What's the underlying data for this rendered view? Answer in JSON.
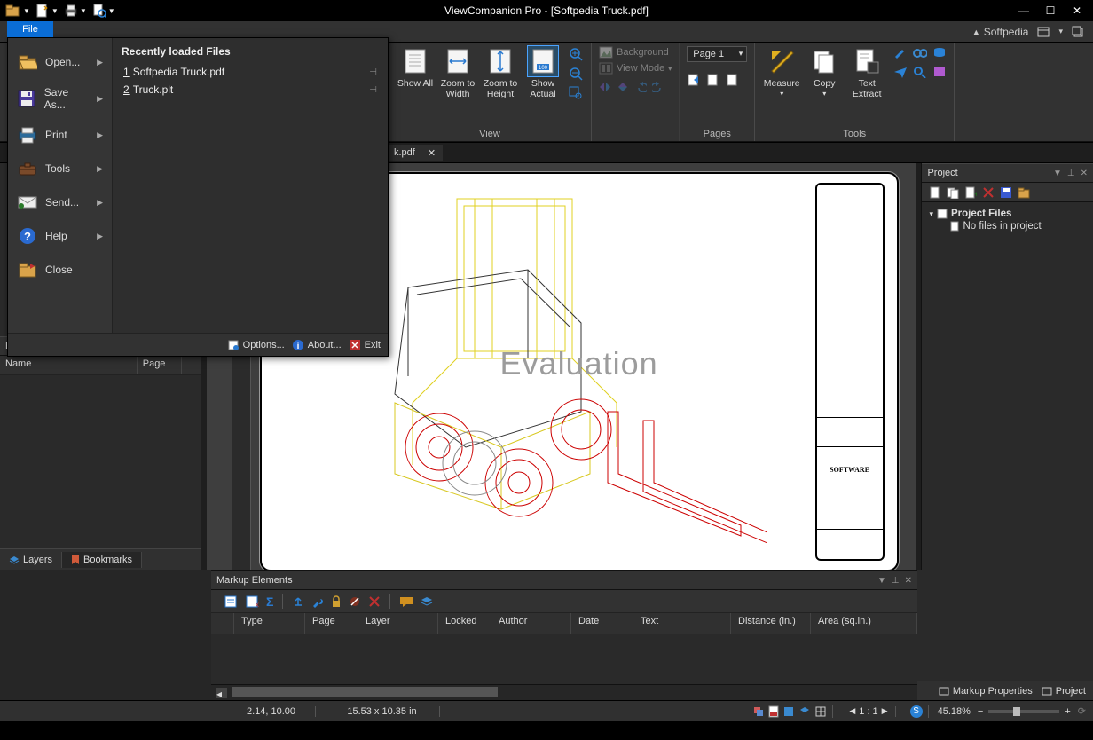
{
  "app_title": "ViewCompanion Pro - [Softpedia Truck.pdf]",
  "brand": "Softpedia",
  "file_tab_label": "File",
  "file_menu": {
    "items": [
      {
        "label": "Open...",
        "arrow": true
      },
      {
        "label": "Save As...",
        "arrow": true
      },
      {
        "label": "Print",
        "arrow": true
      },
      {
        "label": "Tools",
        "arrow": true
      },
      {
        "label": "Send...",
        "arrow": true
      },
      {
        "label": "Help",
        "arrow": true
      },
      {
        "label": "Close",
        "arrow": false
      }
    ],
    "recent_header": "Recently loaded Files",
    "recent": [
      {
        "idx": "1",
        "name": "Softpedia Truck.pdf"
      },
      {
        "idx": "2",
        "name": "Truck.plt"
      }
    ],
    "footer": {
      "options": "Options...",
      "about": "About...",
      "exit": "Exit"
    }
  },
  "ribbon": {
    "view": {
      "show_all": "Show All",
      "zoom_width": "Zoom to Width",
      "zoom_height": "Zoom to Height",
      "show_actual": "Show Actual",
      "group": "View"
    },
    "bg": {
      "background": "Background",
      "viewmode": "View Mode"
    },
    "pages": {
      "page": "Page 1",
      "group": "Pages"
    },
    "measure": "Measure",
    "copy": "Copy",
    "text_extract1": "Text",
    "text_extract2": "Extract",
    "tools_group": "Tools"
  },
  "doc_tab": {
    "name": "k.pdf"
  },
  "bookmarks": {
    "title": "Bookmarks",
    "col_name": "Name",
    "col_page": "Page"
  },
  "left_tabs": {
    "layers": "Layers",
    "bookmarks": "Bookmarks"
  },
  "watermark": "Evaluation",
  "title_block_brand": "SOFTWARE",
  "markup": {
    "title": "Markup Elements",
    "cols": {
      "type": "Type",
      "page": "Page",
      "layer": "Layer",
      "locked": "Locked",
      "author": "Author",
      "date": "Date",
      "text": "Text",
      "distance": "Distance (in.)",
      "area": "Area (sq.in.)"
    }
  },
  "project": {
    "title": "Project",
    "root": "Project Files",
    "empty": "No files in project"
  },
  "right_bottom": {
    "markup_props": "Markup Properties",
    "project": "Project"
  },
  "statusbar": {
    "coords": "2.14, 10.00",
    "size": "15.53 x 10.35 in",
    "ratio": "1 : 1",
    "zoom": "45.18%"
  }
}
